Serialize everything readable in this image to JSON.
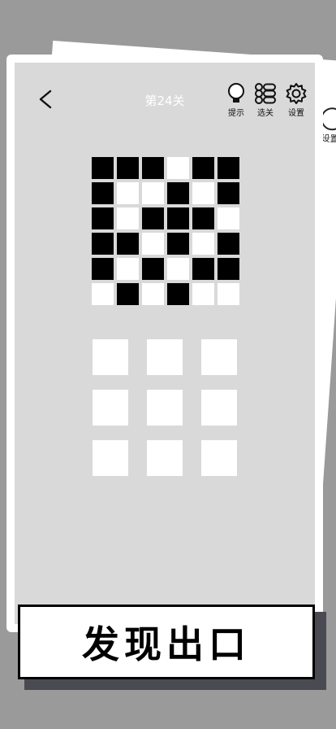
{
  "header": {
    "title": "第24关",
    "tools": {
      "hint_label": "提示",
      "levels_label": "选关",
      "settings_label": "设置"
    },
    "ghost_label": "设置"
  },
  "puzzle": {
    "grid": [
      [
        1,
        1,
        1,
        0,
        1,
        1
      ],
      [
        1,
        0,
        0,
        1,
        0,
        1
      ],
      [
        1,
        0,
        1,
        1,
        1,
        0
      ],
      [
        1,
        1,
        0,
        1,
        0,
        1
      ],
      [
        1,
        0,
        1,
        0,
        1,
        1
      ],
      [
        0,
        1,
        0,
        1,
        0,
        0
      ]
    ],
    "choices": 9
  },
  "banner": {
    "text": "发现出口"
  },
  "colors": {
    "page_bg": "#9a9a9a",
    "panel_bg": "#d9d9d9",
    "dark": "#000000",
    "light": "#ffffff"
  }
}
